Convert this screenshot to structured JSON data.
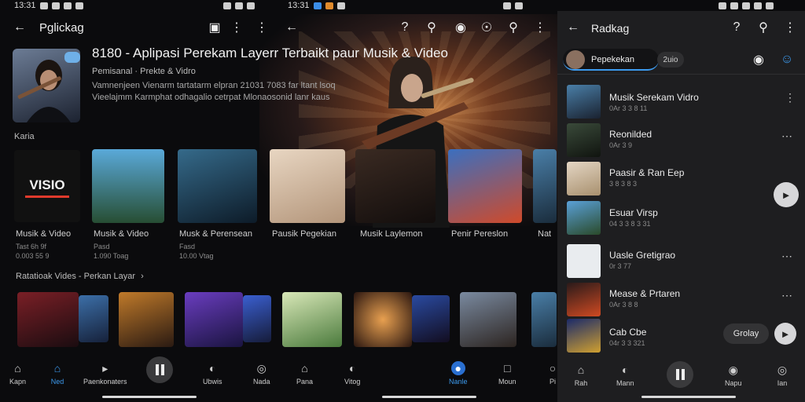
{
  "status": {
    "left_time": "13:31",
    "mid_time": "13:31"
  },
  "left": {
    "header_title": "Pglickag",
    "channel": {
      "title": "8180 - Aplipasi Perekam Layerr Terbaikt paur Musik & Video",
      "subtitle": "Pemisanal · Prekte & Vidro",
      "description": "Vamnenjeen Vienarm tartatarm elpran 21031 7083 far ltant lsoq Vieelajmm Karmphat odhagalio cetrpat Mlonaosonid lanr kaus"
    },
    "section1_label": "Karia",
    "tiles": [
      {
        "title": "Musik & Video",
        "meta1": "Tast 6h 9f",
        "meta2": "0.003 55 9"
      },
      {
        "title": "Musik & Video",
        "meta1": "Pasd",
        "meta2": "1.090 Toag"
      },
      {
        "title": "Musk & Perensean",
        "meta1": "Fasd",
        "meta2": "10.00 Vtag"
      },
      {
        "title": "Pausik Pegekian",
        "meta1": "",
        "meta2": ""
      },
      {
        "title": "Musik Laylemon",
        "meta1": "",
        "meta2": ""
      },
      {
        "title": "Penir Pereslon",
        "meta1": "",
        "meta2": ""
      },
      {
        "title": "Nat",
        "meta1": "",
        "meta2": ""
      }
    ],
    "section2_label": "Ratatioak Vides - Perkan Layar",
    "nav": [
      "Kapn",
      "Ned",
      "Paenkonaters",
      "Ubwis",
      "Nada"
    ]
  },
  "middle": {
    "nav": [
      "Pana",
      "Vitog",
      "Nanle",
      "Moun",
      "Pi"
    ]
  },
  "right": {
    "header_title": "Radkag",
    "chip_active": "Pepekekan",
    "chip2": "2uio",
    "items": [
      {
        "title": "Musik Serekam Vidro",
        "meta": "0Ar 3 3 8 11"
      },
      {
        "title": "Reonilded",
        "meta": "0Ar 3 9"
      },
      {
        "title": "Paasir & Ran Eep",
        "meta": "3 8 3 8 3"
      },
      {
        "title": "Esuar Virsp",
        "meta": "04 3 3 8 3 31"
      },
      {
        "title": "Uasle Gretigrao",
        "meta": "0r 3 77"
      },
      {
        "title": "Mease & Prtaren",
        "meta": "0Ar 3 8 8"
      },
      {
        "title": "Cab Cbe",
        "meta": "04r 3 3 321"
      }
    ],
    "pill_label": "Grolay",
    "nav": [
      "Rah",
      "Mann",
      "Napu",
      "Ian"
    ]
  }
}
